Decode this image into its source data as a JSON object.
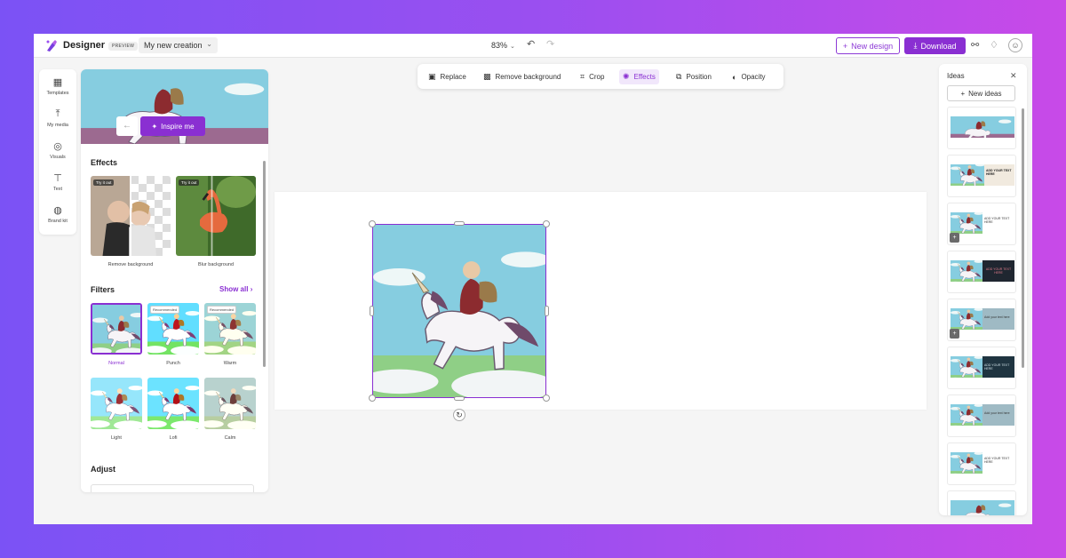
{
  "header": {
    "app_name": "Designer",
    "badge": "PREVIEW",
    "doc_name": "My new creation",
    "zoom": "83%",
    "new_design": "New design",
    "download": "Download"
  },
  "rail": {
    "items": [
      {
        "label": "Templates",
        "icon": "templates-icon"
      },
      {
        "label": "My media",
        "icon": "upload-icon"
      },
      {
        "label": "Visuals",
        "icon": "shapes-icon"
      },
      {
        "label": "Text",
        "icon": "text-icon"
      },
      {
        "label": "Brand kit",
        "icon": "palette-icon"
      }
    ]
  },
  "panel": {
    "inspire": "Inspire me",
    "effects_title": "Effects",
    "effects": [
      {
        "label": "Remove background",
        "badge": "Try it out"
      },
      {
        "label": "Blur background",
        "badge": "Try it out"
      }
    ],
    "filters_title": "Filters",
    "show_all": "Show all",
    "filters": [
      {
        "label": "Normal",
        "badge": ""
      },
      {
        "label": "Punch",
        "badge": "Recommended"
      },
      {
        "label": "Warm",
        "badge": "Recommended"
      },
      {
        "label": "Light",
        "badge": ""
      },
      {
        "label": "Lofi",
        "badge": ""
      },
      {
        "label": "Calm",
        "badge": ""
      }
    ],
    "adjust_title": "Adjust"
  },
  "toolbar": {
    "items": [
      {
        "label": "Replace",
        "icon": "image-icon"
      },
      {
        "label": "Remove background",
        "icon": "remove-bg-icon"
      },
      {
        "label": "Crop",
        "icon": "crop-icon"
      },
      {
        "label": "Effects",
        "icon": "effects-icon"
      },
      {
        "label": "Position",
        "icon": "position-icon"
      },
      {
        "label": "Opacity",
        "icon": "opacity-icon"
      }
    ],
    "active": "Effects"
  },
  "ideas": {
    "title": "Ideas",
    "new_ideas": "New ideas",
    "cards": [
      {
        "text": ""
      },
      {
        "text": "ADD YOUR TEXT HERE"
      },
      {
        "text": "ADD YOUR TEXT HERE"
      },
      {
        "text": "ADD YOUR TEXT HERE"
      },
      {
        "text": "Add your text here"
      },
      {
        "text": "ADD YOUR TEXT HERE"
      },
      {
        "text": "Add your text here"
      },
      {
        "text": "ADD YOUR TEXT HERE"
      }
    ]
  },
  "colors": {
    "accent": "#8a2fd2",
    "sky": "#86cde0",
    "robe": "#8c2b2f"
  }
}
